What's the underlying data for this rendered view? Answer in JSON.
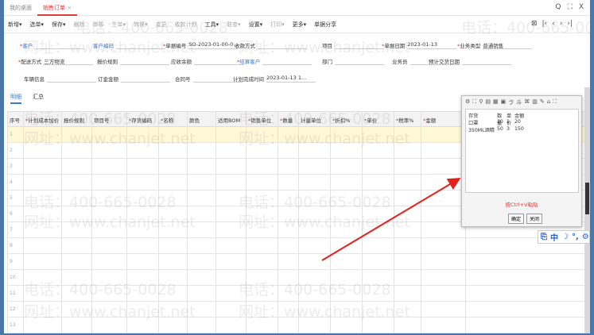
{
  "tabs": [
    "我的桌面",
    "销售订单"
  ],
  "tab_close": "×",
  "window_controls": {
    "search": "Q",
    "maximize": "⛶",
    "close": "X"
  },
  "toolbar": [
    {
      "label": "新增▾",
      "enabled": true
    },
    {
      "label": "选单▾",
      "enabled": true
    },
    {
      "label": "保存▾",
      "enabled": true
    },
    {
      "label": "删除",
      "enabled": false
    },
    {
      "label": "审核",
      "enabled": false
    },
    {
      "label": "生单▾",
      "enabled": false
    },
    {
      "label": "转换▾",
      "enabled": false
    },
    {
      "label": "变更",
      "enabled": false
    },
    {
      "label": "收款计划",
      "enabled": false
    },
    {
      "label": "工具▾",
      "enabled": true
    },
    {
      "label": "联查▾",
      "enabled": false
    },
    {
      "label": "设置▾",
      "enabled": true
    },
    {
      "label": "打印▾",
      "enabled": false
    },
    {
      "label": "更多▾",
      "enabled": true
    },
    {
      "label": "单据分享",
      "enabled": true
    }
  ],
  "nav": [
    "⊠",
    "|‹",
    "‹",
    "›",
    "›|"
  ],
  "form": {
    "customer": {
      "label": "客户",
      "value": ""
    },
    "customer_code": {
      "label": "客户编码",
      "value": ""
    },
    "doc_no": {
      "label": "单据编号",
      "value": "SO-2023-01-00-0..."
    },
    "payment_method": {
      "label": "收款方式",
      "value": ""
    },
    "project": {
      "label": "项目",
      "value": ""
    },
    "doc_date": {
      "label": "单据日期",
      "value": "2023-01-13"
    },
    "biz_type": {
      "label": "业务类型",
      "value": "普通销售"
    },
    "delivery": {
      "label": "配送方式",
      "value": "三方物流"
    },
    "quote_rule": {
      "label": "报价规则",
      "value": ""
    },
    "receivable": {
      "label": "应收余额",
      "value": ""
    },
    "settle_customer": {
      "label": "结算客户",
      "value": ""
    },
    "department": {
      "label": "部门",
      "value": ""
    },
    "salesman": {
      "label": "业务员",
      "value": ""
    },
    "expected_delivery": {
      "label": "预计交货日期",
      "value": ""
    },
    "vehicle": {
      "label": "车辆信息",
      "value": ""
    },
    "order_amount": {
      "label": "订金金额",
      "value": ""
    },
    "contract": {
      "label": "合同号",
      "value": ""
    },
    "plan_finish": {
      "label": "计划完成时间",
      "value": "2023-01-13 1..."
    }
  },
  "subtabs": [
    "明细",
    "汇总"
  ],
  "grid": {
    "columns": [
      "序号",
      "计划成本加价",
      "报价规则",
      "项目号",
      "存货编码",
      "名称",
      "颜色",
      "适用BOM",
      "销售单位",
      "数量",
      "计量单位",
      "折扣%",
      "单价",
      "税率%",
      "金额"
    ],
    "required": [
      false,
      true,
      false,
      false,
      true,
      true,
      false,
      false,
      true,
      true,
      false,
      true,
      true,
      true,
      true
    ],
    "rows": [
      "1",
      "2",
      "3",
      "4",
      "5",
      "6",
      "7",
      "8",
      "9",
      "10",
      "11",
      "12",
      "13"
    ]
  },
  "watermark": {
    "phone": "电话：400-665-0028",
    "site": "网址：www.chanjet.net"
  },
  "paste_popup": {
    "tools": [
      "⚙",
      "⛶",
      "⚲",
      "▤",
      "▦",
      "▣",
      "ゔ",
      "⽃",
      "⌘",
      "▥",
      "✎",
      "⌂",
      "⛶"
    ],
    "lines": [
      [
        "存货",
        "数量",
        "单价",
        "金额"
      ],
      [
        "口罩",
        "20",
        "1",
        "20"
      ],
      [
        "350ML酒精",
        "50",
        "3",
        "150"
      ]
    ],
    "hint": "按Ctrl+V粘贴",
    "ok": "确定",
    "close": "关闭"
  },
  "ime": [
    "⎘",
    "中",
    "☽",
    "°,",
    "⚙"
  ],
  "colors": {
    "accent": "#e0393e",
    "link": "#3a7bd5",
    "frame": "#4a76a8",
    "selected_row": "#fff8d6"
  }
}
